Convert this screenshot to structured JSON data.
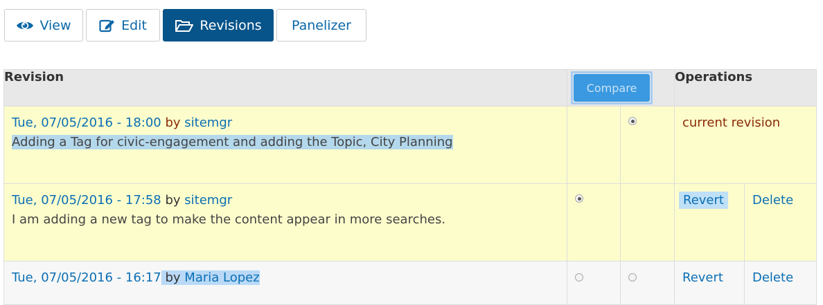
{
  "tabs": [
    {
      "label": "View",
      "icon": "eye-icon",
      "active": false
    },
    {
      "label": "Edit",
      "icon": "edit-icon",
      "active": false
    },
    {
      "label": "Revisions",
      "icon": "folder-open-icon",
      "active": true
    },
    {
      "label": "Panelizer",
      "active": false
    }
  ],
  "table": {
    "headers": {
      "revision": "Revision",
      "compare": "Compare",
      "operations": "Operations"
    },
    "rows": [
      {
        "date": "Tue, 07/05/2016 - 18:00",
        "by": "by",
        "author": "sitemgr",
        "message": "Adding a Tag for civic-engagement and adding the Topic, City Planning",
        "left_radio": null,
        "right_radio": true,
        "status": "current revision"
      },
      {
        "date": "Tue, 07/05/2016 - 17:58",
        "by": "by",
        "author": "sitemgr",
        "message": "I am adding a new tag to make the content appear in more searches.",
        "left_radio": true,
        "right_radio": null,
        "revert": "Revert",
        "delete": "Delete"
      },
      {
        "date": "Tue, 07/05/2016 - 16:17",
        "by": "by",
        "author": "Maria Lopez",
        "left_radio": false,
        "right_radio": false,
        "revert": "Revert",
        "delete": "Delete"
      }
    ]
  },
  "colors": {
    "tab_active": "#07548a",
    "link": "#0b6fb4",
    "row_highlight": "#fdfdcc",
    "compare_button": "#3a99e0"
  }
}
